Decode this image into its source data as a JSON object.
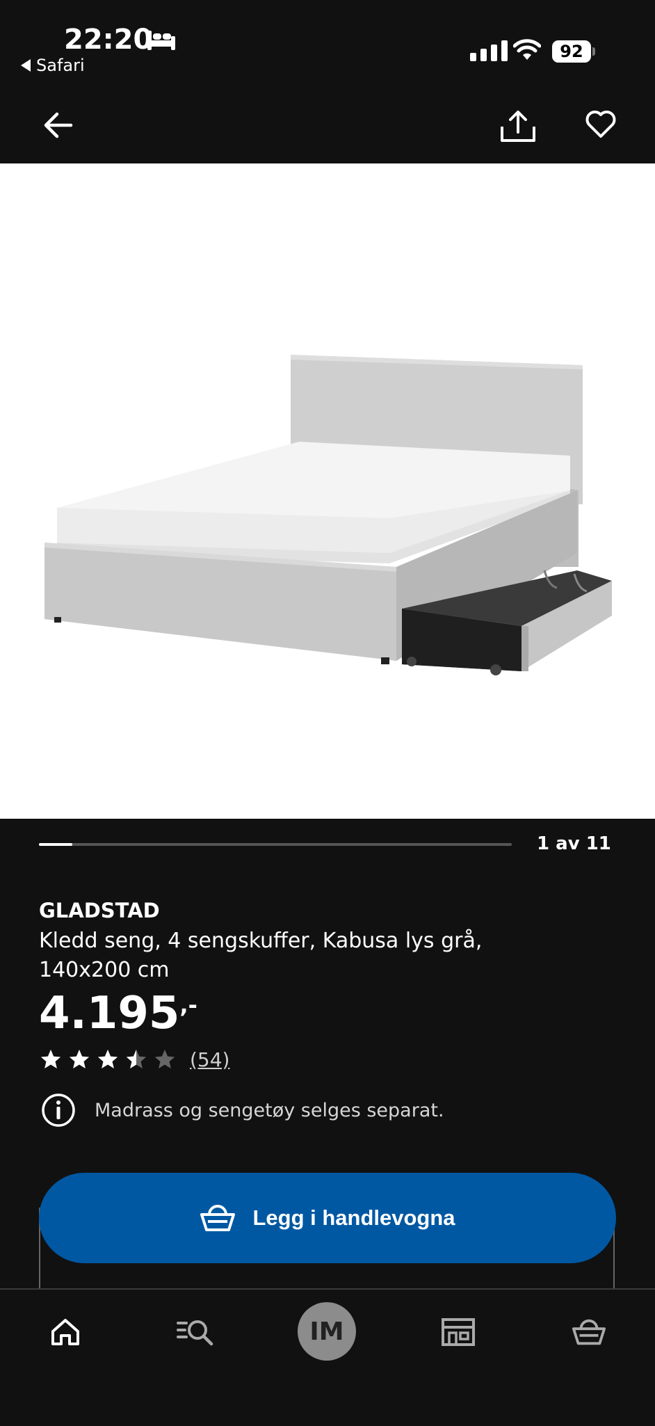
{
  "status_bar": {
    "time": "22:20",
    "back_app": "Safari",
    "battery": "92"
  },
  "icons": {
    "bed": "bed-icon",
    "back": "arrow-left-icon",
    "share": "share-icon",
    "favorite": "heart-icon",
    "info": "info-icon",
    "cart": "basket-icon",
    "home": "home-icon",
    "search": "search-icon",
    "store": "store-icon",
    "basket": "basket-icon"
  },
  "gallery": {
    "counter": "1 av 11",
    "progress": 0.07
  },
  "product": {
    "brand": "GLADSTAD",
    "description": "Kledd seng, 4 sengskuffer, Kabusa lys grå, 140x200 cm",
    "price": "4.195",
    "price_suffix": ",-",
    "rating": 3.5,
    "review_count": "(54)",
    "note": "Madrass og sengetøy selges separat."
  },
  "cta": {
    "label": "Legg i handlevogna",
    "color": "#0058a3"
  },
  "tabbar": {
    "avatar_initials": "IM"
  },
  "colors": {
    "background": "#111111",
    "accent": "#0058a3"
  }
}
